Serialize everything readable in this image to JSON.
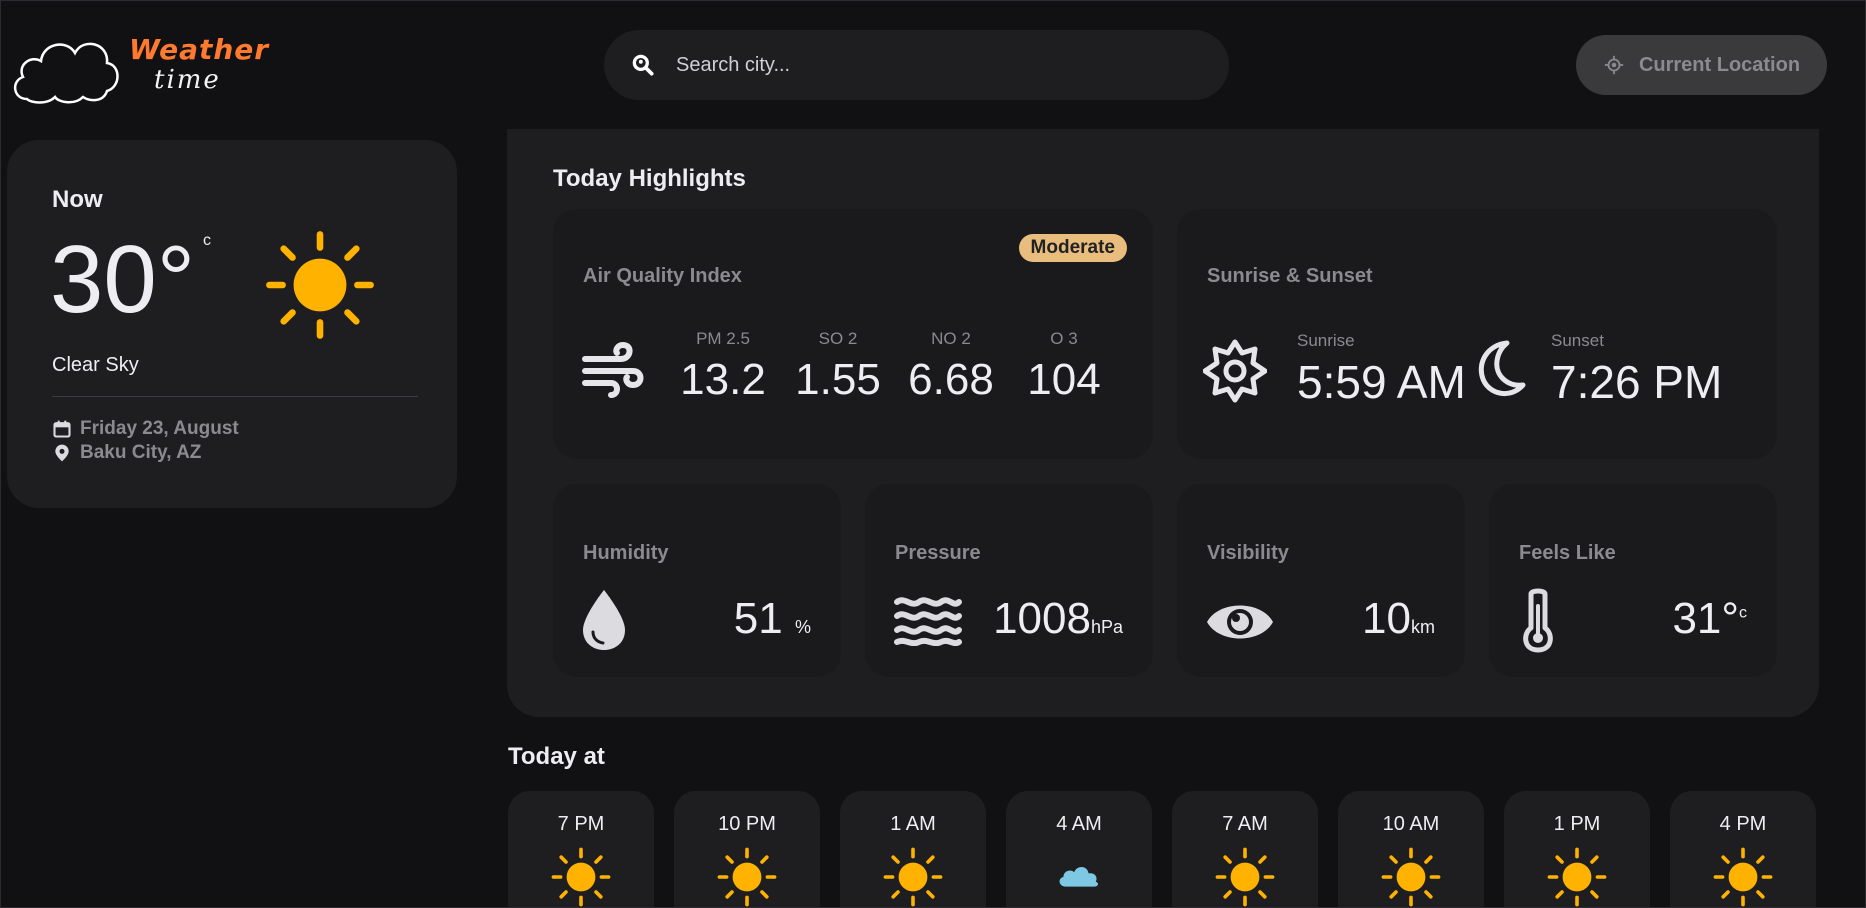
{
  "header": {
    "logo_line1": "Weather",
    "logo_line2": "time",
    "search_placeholder": "Search city...",
    "location_button": "Current Location"
  },
  "now": {
    "label": "Now",
    "temperature": "30°",
    "unit": "c",
    "condition": "Clear Sky",
    "date": "Friday 23, August",
    "location": "Baku City, AZ",
    "icon": "sun-icon"
  },
  "highlights": {
    "title": "Today Highlights",
    "air_quality": {
      "title": "Air Quality Index",
      "badge": "Moderate",
      "items": [
        {
          "label": "PM 2.5",
          "value": "13.2"
        },
        {
          "label": "SO 2",
          "value": "1.55"
        },
        {
          "label": "NO 2",
          "value": "6.68"
        },
        {
          "label": "O 3",
          "value": "104"
        }
      ]
    },
    "sun": {
      "title": "Sunrise & Sunset",
      "sunrise_label": "Sunrise",
      "sunrise": "5:59 AM",
      "sunset_label": "Sunset",
      "sunset": "7:26 PM"
    },
    "humidity": {
      "title": "Humidity",
      "value": "51",
      "unit": "%"
    },
    "pressure": {
      "title": "Pressure",
      "value": "1008",
      "unit": "hPa"
    },
    "visibility": {
      "title": "Visibility",
      "value": "10",
      "unit": "km"
    },
    "feels_like": {
      "title": "Feels Like",
      "value": "31°",
      "unit": "c"
    }
  },
  "today": {
    "title": "Today at",
    "hours": [
      {
        "time": "7 PM",
        "icon": "sun-icon"
      },
      {
        "time": "10 PM",
        "icon": "sun-icon"
      },
      {
        "time": "1 AM",
        "icon": "sun-icon"
      },
      {
        "time": "4 AM",
        "icon": "cloud-icon"
      },
      {
        "time": "7 AM",
        "icon": "sun-icon"
      },
      {
        "time": "10 AM",
        "icon": "sun-icon"
      },
      {
        "time": "1 PM",
        "icon": "sun-icon"
      },
      {
        "time": "4 PM",
        "icon": "sun-icon"
      }
    ]
  },
  "colors": {
    "accent_sun": "#ffb300",
    "logo_orange": "#ff7a2f",
    "badge": "#e8bd7e",
    "cloud": "#7ec8e3"
  }
}
